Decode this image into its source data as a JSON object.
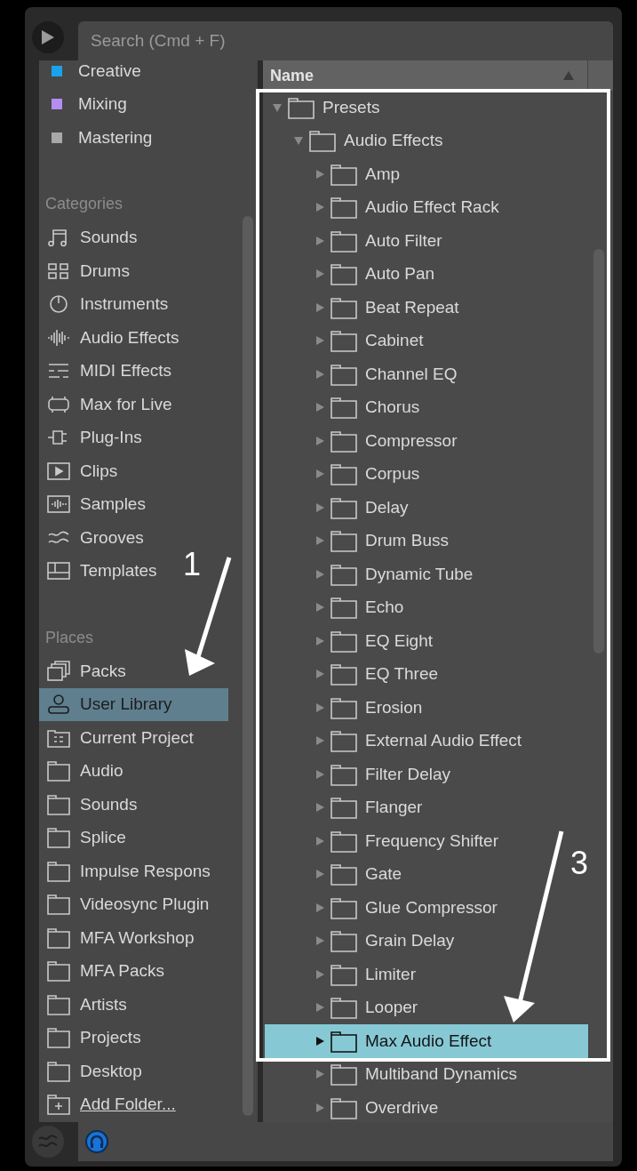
{
  "search": {
    "placeholder": "Search (Cmd + F)"
  },
  "sidebar": {
    "collections": [
      {
        "label": "Creative",
        "color": "#1aa3ea"
      },
      {
        "label": "Mixing",
        "color": "#b58cf0"
      },
      {
        "label": "Mastering",
        "color": "#a8a8a8"
      }
    ],
    "sections": [
      {
        "title": "Categories",
        "items": [
          {
            "label": "Sounds",
            "kind": "note",
            "selected": false
          },
          {
            "label": "Drums",
            "kind": "pads",
            "selected": false
          },
          {
            "label": "Instruments",
            "kind": "knob",
            "selected": false
          },
          {
            "label": "Audio Effects",
            "kind": "wave",
            "selected": false
          },
          {
            "label": "MIDI Effects",
            "kind": "midi",
            "selected": false
          },
          {
            "label": "Max for Live",
            "kind": "max",
            "selected": false
          },
          {
            "label": "Plug-Ins",
            "kind": "plug",
            "selected": false
          },
          {
            "label": "Clips",
            "kind": "clip",
            "selected": false
          },
          {
            "label": "Samples",
            "kind": "sample",
            "selected": false
          },
          {
            "label": "Grooves",
            "kind": "groove",
            "selected": false
          },
          {
            "label": "Templates",
            "kind": "template",
            "selected": false
          }
        ]
      },
      {
        "title": "Places",
        "items": [
          {
            "label": "Packs",
            "kind": "packs",
            "selected": false
          },
          {
            "label": "User Library",
            "kind": "user",
            "selected": true
          },
          {
            "label": "Current Project",
            "kind": "project",
            "selected": false
          },
          {
            "label": "Audio",
            "kind": "folder",
            "selected": false
          },
          {
            "label": "Sounds",
            "kind": "folder",
            "selected": false
          },
          {
            "label": "Splice",
            "kind": "folder",
            "selected": false
          },
          {
            "label": "Impulse Respons",
            "kind": "folder",
            "selected": false
          },
          {
            "label": "Videosync Plugin",
            "kind": "folder",
            "selected": false
          },
          {
            "label": "MFA Workshop",
            "kind": "folder",
            "selected": false
          },
          {
            "label": "MFA Packs",
            "kind": "folder",
            "selected": false
          },
          {
            "label": "Artists",
            "kind": "folder",
            "selected": false
          },
          {
            "label": "Projects",
            "kind": "folder",
            "selected": false
          },
          {
            "label": "Desktop",
            "kind": "folder",
            "selected": false
          },
          {
            "label": "Add Folder...",
            "kind": "add",
            "selected": false
          }
        ]
      }
    ]
  },
  "browser": {
    "column": "Name",
    "tree": [
      {
        "label": "Presets",
        "expanded": true,
        "selected": false,
        "children": [
          {
            "label": "Audio Effects",
            "expanded": true,
            "selected": false,
            "children": [
              {
                "label": "Amp",
                "expanded": false,
                "selected": false
              },
              {
                "label": "Audio Effect Rack",
                "expanded": false,
                "selected": false
              },
              {
                "label": "Auto Filter",
                "expanded": false,
                "selected": false
              },
              {
                "label": "Auto Pan",
                "expanded": false,
                "selected": false
              },
              {
                "label": "Beat Repeat",
                "expanded": false,
                "selected": false
              },
              {
                "label": "Cabinet",
                "expanded": false,
                "selected": false
              },
              {
                "label": "Channel EQ",
                "expanded": false,
                "selected": false
              },
              {
                "label": "Chorus",
                "expanded": false,
                "selected": false
              },
              {
                "label": "Compressor",
                "expanded": false,
                "selected": false
              },
              {
                "label": "Corpus",
                "expanded": false,
                "selected": false
              },
              {
                "label": "Delay",
                "expanded": false,
                "selected": false
              },
              {
                "label": "Drum Buss",
                "expanded": false,
                "selected": false
              },
              {
                "label": "Dynamic Tube",
                "expanded": false,
                "selected": false
              },
              {
                "label": "Echo",
                "expanded": false,
                "selected": false
              },
              {
                "label": "EQ Eight",
                "expanded": false,
                "selected": false
              },
              {
                "label": "EQ Three",
                "expanded": false,
                "selected": false
              },
              {
                "label": "Erosion",
                "expanded": false,
                "selected": false
              },
              {
                "label": "External Audio Effect",
                "expanded": false,
                "selected": false
              },
              {
                "label": "Filter Delay",
                "expanded": false,
                "selected": false
              },
              {
                "label": "Flanger",
                "expanded": false,
                "selected": false
              },
              {
                "label": "Frequency Shifter",
                "expanded": false,
                "selected": false
              },
              {
                "label": "Gate",
                "expanded": false,
                "selected": false
              },
              {
                "label": "Glue Compressor",
                "expanded": false,
                "selected": false
              },
              {
                "label": "Grain Delay",
                "expanded": false,
                "selected": false
              },
              {
                "label": "Limiter",
                "expanded": false,
                "selected": false
              },
              {
                "label": "Looper",
                "expanded": false,
                "selected": false
              },
              {
                "label": "Max Audio Effect",
                "expanded": false,
                "selected": true
              },
              {
                "label": "Multiband Dynamics",
                "expanded": false,
                "selected": false
              },
              {
                "label": "Overdrive",
                "expanded": false,
                "selected": false
              }
            ]
          }
        ]
      }
    ]
  },
  "annotations": [
    {
      "label": "1"
    },
    {
      "label": "3"
    }
  ]
}
